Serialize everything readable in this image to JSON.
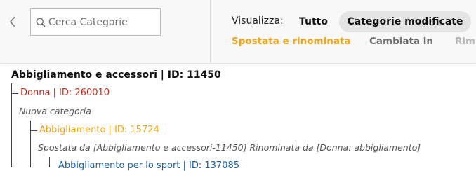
{
  "header": {
    "back_icon": "chevron-left-icon",
    "search": {
      "icon": "search-icon",
      "placeholder": "Cerca Categorie",
      "value": ""
    },
    "view_label": "Visualizza:",
    "view_options": {
      "all": "Tutto",
      "modified": "Categorie modificate",
      "selected": "Categorie modificate"
    },
    "filter_tabs": [
      {
        "label": "Spostata e rinominata",
        "active": true,
        "color": "#f2a516"
      },
      {
        "label": "Cambiata in",
        "active": false,
        "color": "#6f6f6f"
      },
      {
        "label": "Rim",
        "active": false,
        "color": "#b8b8b8"
      }
    ]
  },
  "tree": {
    "root": {
      "label": "Abbigliamento e accessori | ID: 11450"
    },
    "donna": {
      "label": "Donna | ID: 260010",
      "note": "Nuova categoria",
      "color": "#d12619"
    },
    "abbigliamento": {
      "label": "Abbigliamento | ID: 15724",
      "note": "Spostata da [Abbigliamento e accessori-11450] Rinominata da [Donna: abbigliamento]",
      "color": "#f2a516"
    },
    "sport": {
      "label": "Abbigliamento per lo sport | ID: 137085",
      "color": "#1a5fa6"
    }
  }
}
